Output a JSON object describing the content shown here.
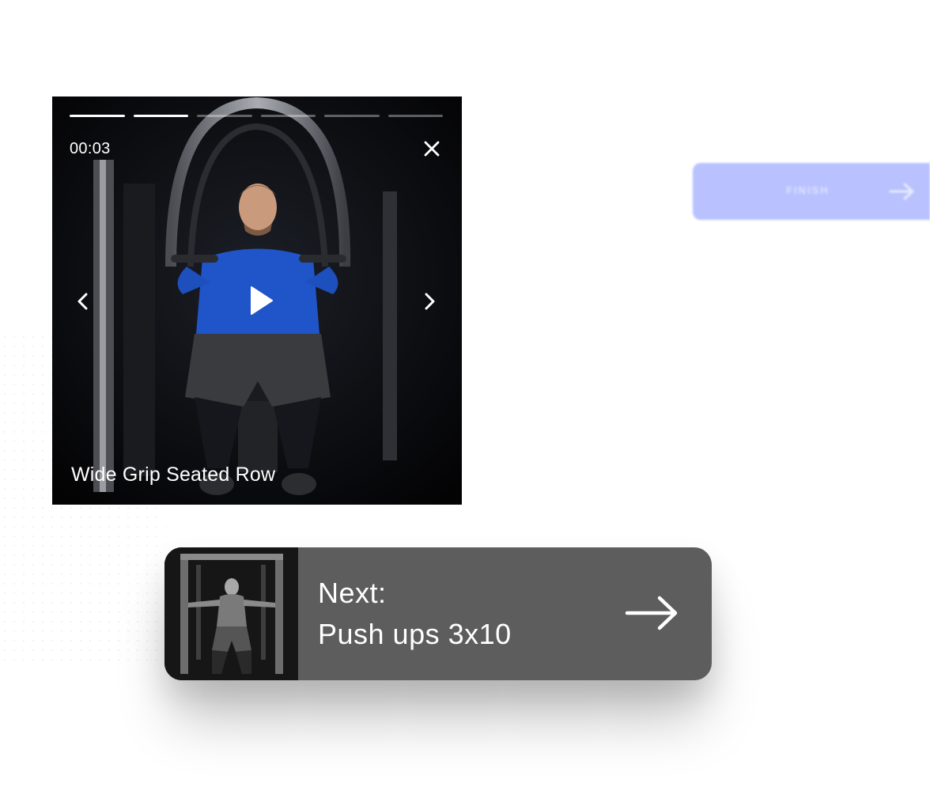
{
  "player": {
    "timer": "00:03",
    "exercise_title": "Wide Grip Seated Row",
    "progress": {
      "completed_segments": 2,
      "total_segments": 6
    },
    "icons": {
      "close": "close-icon",
      "prev": "chevron-left-icon",
      "next": "chevron-right-icon",
      "play": "play-icon"
    }
  },
  "finish_button": {
    "label": "FINISH",
    "icon": "arrow-right-icon",
    "color": "#b9c2ff"
  },
  "next_card": {
    "prefix": "Next:",
    "exercise": "Push ups 3x10",
    "icon": "arrow-right-icon",
    "background": "#5d5d5d"
  }
}
